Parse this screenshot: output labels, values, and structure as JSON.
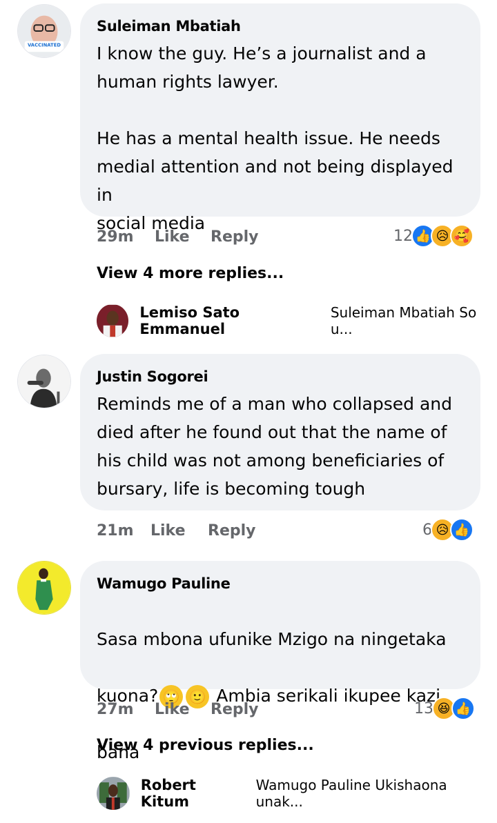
{
  "comments": [
    {
      "author": "Suleiman Mbatiah",
      "text": "I know the guy. He’s a journalist and a\nhuman rights lawyer.\n\nHe has a mental health issue. He needs\nmedial attention and not being displayed in\nsocial media",
      "time": "29m",
      "like_label": "Like",
      "reply_label": "Reply",
      "reaction_count": "12",
      "reactions": [
        "like-icon",
        "sad-icon",
        "care-icon"
      ],
      "view_more": "View 4 more replies...",
      "reply_preview": {
        "name": "Lemiso Sato Emmanuel",
        "snippet": "Suleiman Mbatiah So u..."
      },
      "avatar_badge": "VACCINATED"
    },
    {
      "author": "Justin Sogorei",
      "text": "Reminds me of a man who collapsed and\ndied after he found out that the name of\nhis child was not among beneficiaries of\nbursary, life is becoming tough",
      "time": "21m",
      "like_label": "Like",
      "reply_label": "Reply",
      "reaction_count": "6",
      "reactions": [
        "sad-icon",
        "like-icon"
      ]
    },
    {
      "author": "Wamugo Pauline",
      "text_line1": "Sasa mbona ufunike Mzigo na ningetaka",
      "text_line2a": "kuona?",
      "text_line2b": "Ambia serikali ikupee kazi",
      "text_line3": "bana",
      "emojis": [
        "eye-roll-emoji",
        "smile-emoji"
      ],
      "time": "27m",
      "like_label": "Like",
      "reply_label": "Reply",
      "reaction_count": "13",
      "reactions": [
        "haha-icon",
        "like-icon"
      ],
      "view_more": "View 4 previous replies...",
      "reply_preview": {
        "name": "Robert Kitum",
        "snippet": "Wamugo Pauline Ukishaona unak..."
      }
    }
  ],
  "colors": {
    "bubble": "#f0f2f5",
    "meta": "#65676b",
    "like": "#1877f2",
    "emoji": "#f7b125"
  }
}
